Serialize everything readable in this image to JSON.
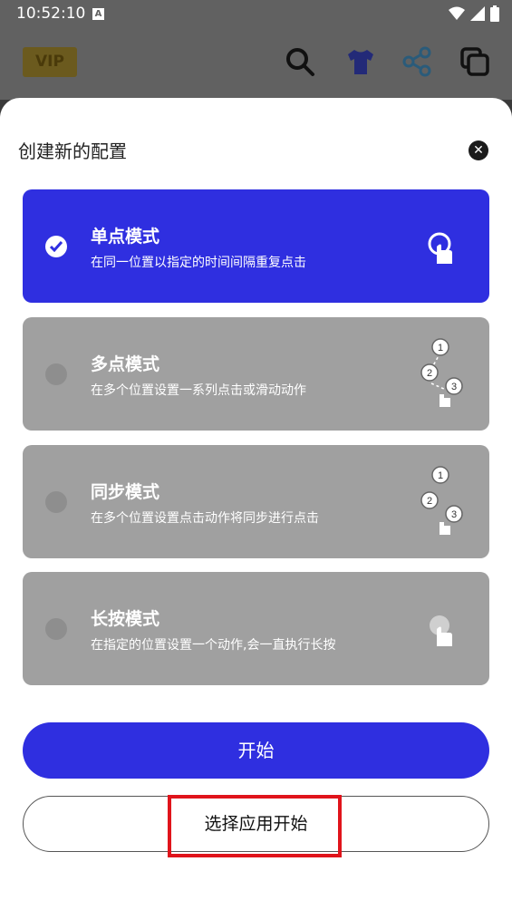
{
  "status_bar": {
    "time": "10:52:10",
    "a_badge": "A"
  },
  "app_bar": {
    "vip_label": "VIP",
    "icons": [
      "search-icon",
      "tshirt-icon",
      "share-icon",
      "copy-icon"
    ]
  },
  "sheet": {
    "title": "创建新的配置",
    "close_icon": "close-icon"
  },
  "modes": [
    {
      "name": "单点模式",
      "desc": "在同一位置以指定的时间间隔重复点击",
      "selected": true,
      "icon": "single-tap-icon"
    },
    {
      "name": "多点模式",
      "desc": "在多个位置设置一系列点击或滑动动作",
      "selected": false,
      "icon": "multi-tap-icon"
    },
    {
      "name": "同步模式",
      "desc": "在多个位置设置点击动作将同步进行点击",
      "selected": false,
      "icon": "sync-tap-icon"
    },
    {
      "name": "长按模式",
      "desc": "在指定的位置设置一个动作,会一直执行长按",
      "selected": false,
      "icon": "long-press-icon"
    }
  ],
  "buttons": {
    "start": "开始",
    "pick_app_start": "选择应用开始"
  },
  "colors": {
    "accent": "#2f2fe0",
    "card_inactive": "#a0a0a0",
    "highlight": "#e0141b"
  }
}
